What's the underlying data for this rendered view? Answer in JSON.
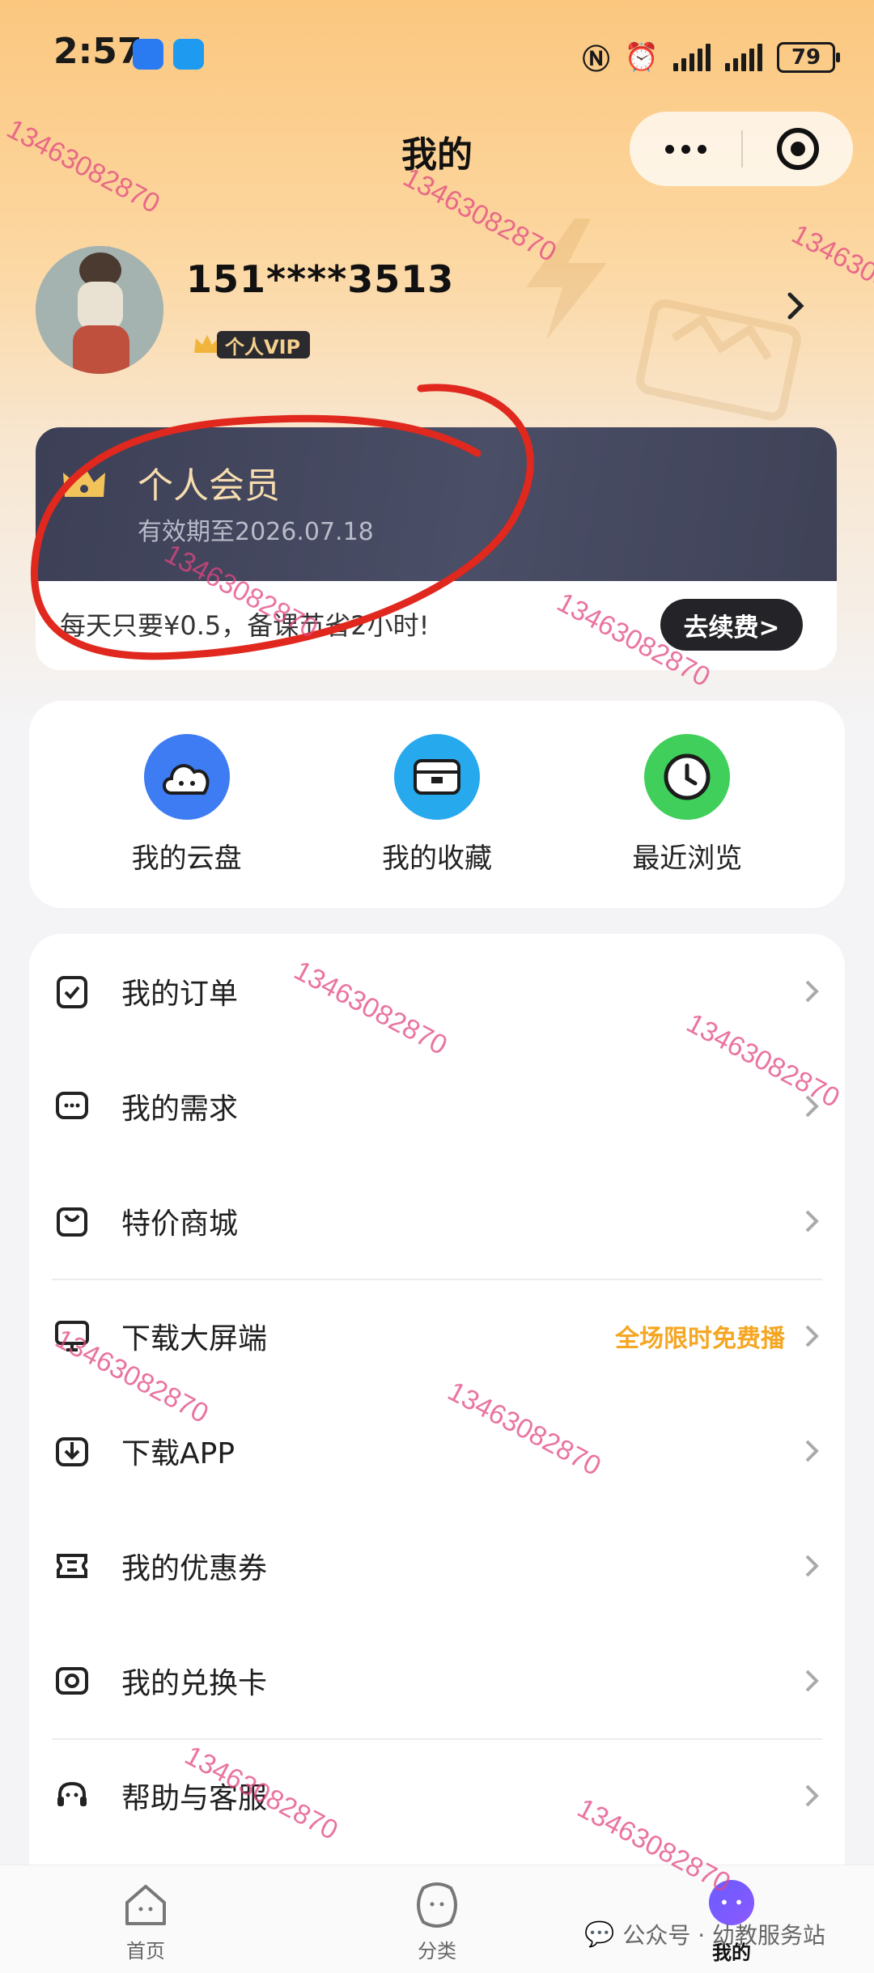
{
  "status_bar": {
    "time": "2:57",
    "battery": "79"
  },
  "nav": {
    "title": "我的"
  },
  "profile": {
    "phone": "151****3513",
    "vip_label": "个人VIP"
  },
  "member": {
    "title": "个人会员",
    "expiry": "有效期至2026.07.18",
    "promo": "每天只要¥0.5，备课节省2小时!",
    "renew_label": "去续费>"
  },
  "quick_access": [
    {
      "label": "我的云盘",
      "icon": "cloud-icon",
      "color": "#3d7cf2"
    },
    {
      "label": "我的收藏",
      "icon": "bookmark-box-icon",
      "color": "#27a9ee"
    },
    {
      "label": "最近浏览",
      "icon": "clock-icon",
      "color": "#3fcf5a"
    }
  ],
  "menu": [
    {
      "label": "我的订单",
      "icon": "order-icon"
    },
    {
      "label": "我的需求",
      "icon": "message-icon"
    },
    {
      "label": "特价商城",
      "icon": "shopping-bag-icon"
    },
    {
      "label": "下载大屏端",
      "icon": "monitor-icon",
      "badge": "全场限时免费播"
    },
    {
      "label": "下载APP",
      "icon": "download-icon"
    },
    {
      "label": "我的优惠券",
      "icon": "coupon-icon"
    },
    {
      "label": "我的兑换卡",
      "icon": "exchange-card-icon"
    },
    {
      "label": "帮助与客服",
      "icon": "customer-service-icon"
    }
  ],
  "tabs": [
    {
      "label": "首页",
      "icon": "home-icon"
    },
    {
      "label": "分类",
      "icon": "category-icon"
    },
    {
      "label": "我的",
      "icon": "profile-icon",
      "active": true
    }
  ],
  "wechat_mark": {
    "text": "公众号 · 幼教服务站"
  },
  "watermark_text": "13463082870",
  "colors": {
    "accent": "#f5a623",
    "member_card": "#3c3f55",
    "annotation_red": "#e0281e"
  }
}
